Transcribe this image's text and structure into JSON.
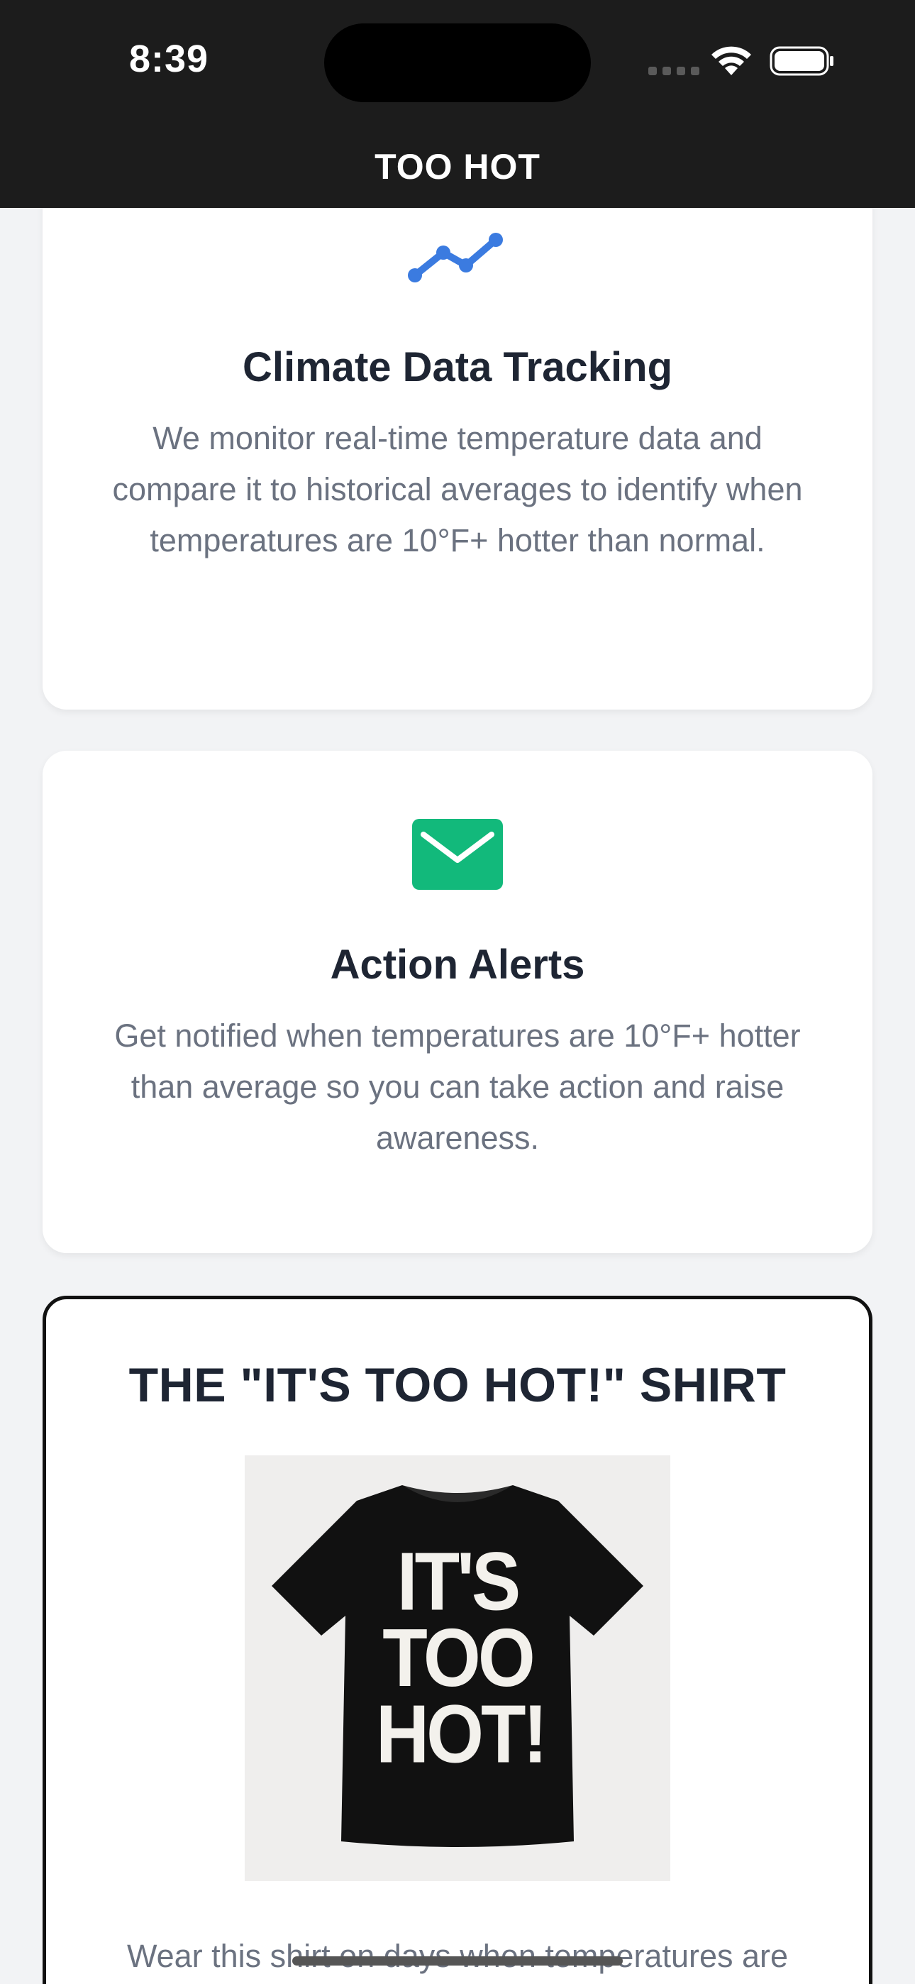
{
  "status_bar": {
    "time": "8:39"
  },
  "header": {
    "title": "TOO HOT"
  },
  "features": [
    {
      "icon": "trend-line-icon",
      "icon_color": "#3b7be0",
      "title": "Climate Data Tracking",
      "description": "We monitor real-time temperature data and compare it to historical averages to identify when temperatures are 10°F+ hotter than normal."
    },
    {
      "icon": "mail-icon",
      "icon_color": "#12b97b",
      "title": "Action Alerts",
      "description": "Get notified when temperatures are 10°F+ hotter than average so you can take action and raise awareness."
    }
  ],
  "shirt_card": {
    "title": "THE \"IT'S TOO HOT!\" SHIRT",
    "graphic_text": [
      "IT'S",
      "TOO",
      "HOT!"
    ],
    "description": "Wear this shirt on days when temperatures are"
  },
  "colors": {
    "header_bg": "#1c1c1c",
    "page_bg": "#f2f3f5",
    "title_text": "#1e2533",
    "body_text": "#6b7280"
  }
}
